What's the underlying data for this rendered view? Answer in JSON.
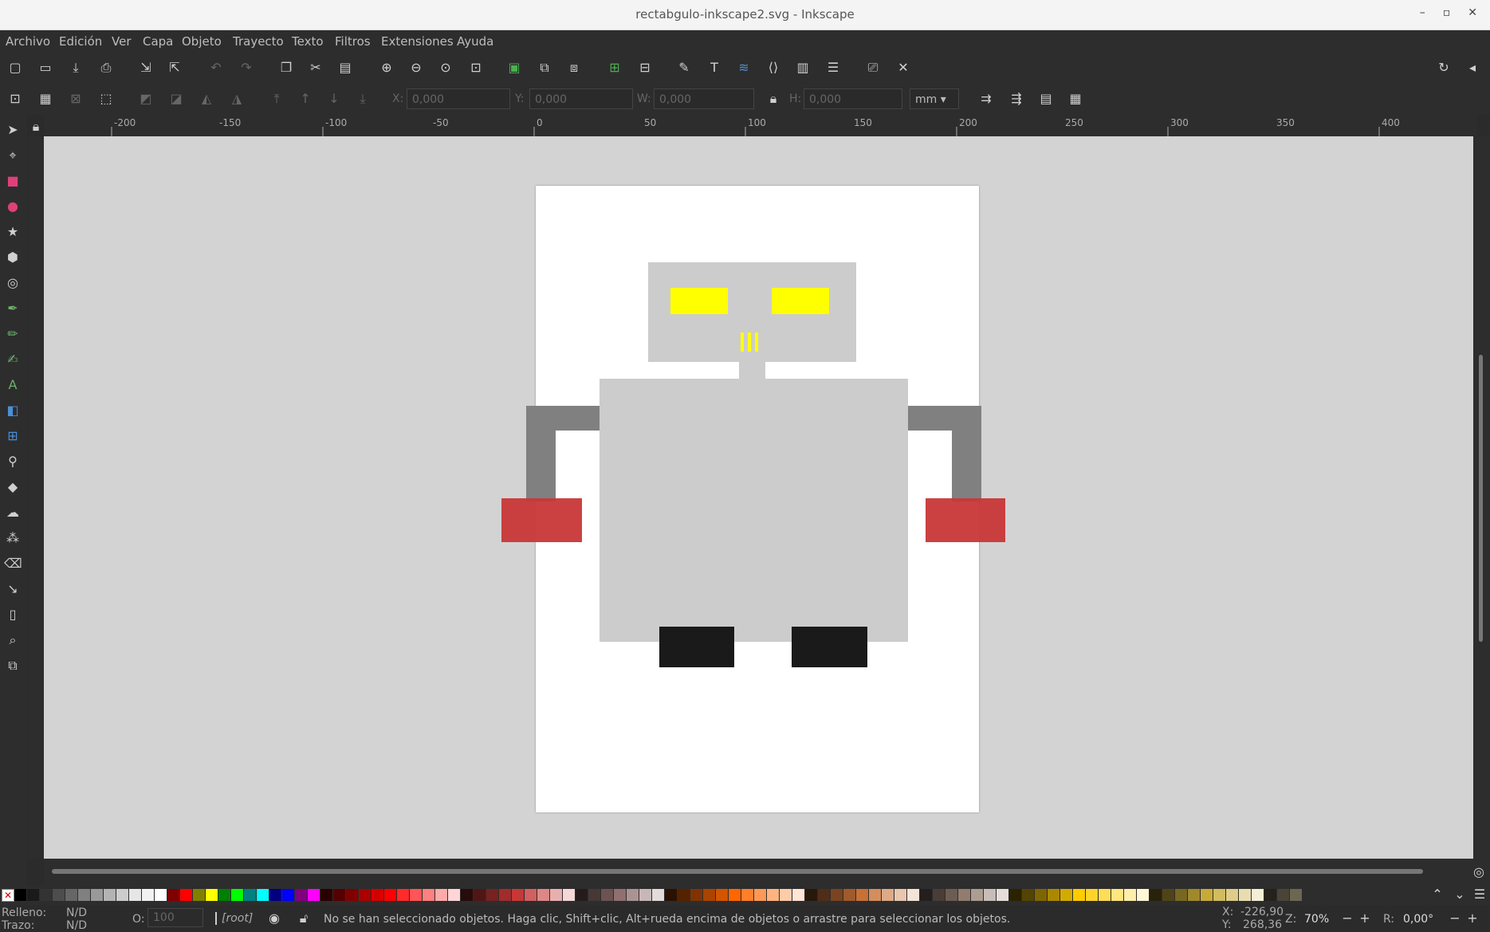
{
  "window": {
    "title": "rectabgulo-inkscape2.svg - Inkscape",
    "minimize": "–",
    "maximize": "▫",
    "close": "✕"
  },
  "menu": [
    "Archivo",
    "Edición",
    "Ver",
    "Capa",
    "Objeto",
    "Trayecto",
    "Texto",
    "Filtros",
    "Extensiones",
    "Ayuda"
  ],
  "toolbar": {
    "x_label": "X:",
    "x_value": "0,000",
    "y_label": "Y:",
    "y_value": "0,000",
    "w_label": "W:",
    "w_value": "0,000",
    "h_label": "H:",
    "h_value": "0,000",
    "unit": "mm"
  },
  "ruler": {
    "h_labels": [
      "-200",
      "-150",
      "-100",
      "-50",
      "0",
      "50",
      "100",
      "150",
      "200",
      "250",
      "300",
      "350",
      "400"
    ]
  },
  "colors": {
    "robot_gray": "#cccccc",
    "eyes": "#ffff00",
    "arm": "#808080",
    "hand": "#c83737",
    "foot": "#1a1a1a",
    "page": "#ffffff",
    "canvas": "#d3d3d3"
  },
  "palette": [
    "#000000",
    "#1a1a1a",
    "#333333",
    "#4d4d4d",
    "#666666",
    "#808080",
    "#999999",
    "#b3b3b3",
    "#cccccc",
    "#e6e6e6",
    "#f2f2f2",
    "#ffffff",
    "#800000",
    "#ff0000",
    "#808000",
    "#ffff00",
    "#008000",
    "#00ff00",
    "#008080",
    "#00ffff",
    "#000080",
    "#0000ff",
    "#800080",
    "#ff00ff",
    "#2b0000",
    "#550000",
    "#800000",
    "#aa0000",
    "#d40000",
    "#ff0000",
    "#ff2a2a",
    "#ff5555",
    "#ff8080",
    "#ffaaaa",
    "#ffd5d5",
    "#280b0b",
    "#501616",
    "#782121",
    "#a02c2c",
    "#c83737",
    "#d35f5f",
    "#de8787",
    "#e9afaf",
    "#f4d7d7",
    "#241c1c",
    "#483737",
    "#6c5353",
    "#916f6f",
    "#ac9393",
    "#c8b7b7",
    "#e3dbdb",
    "#2b1100",
    "#552200",
    "#803300",
    "#aa4400",
    "#d45500",
    "#ff6600",
    "#ff7f2a",
    "#ff9955",
    "#ffb380",
    "#ffccaa",
    "#ffe6d5",
    "#28170b",
    "#502d16",
    "#784421",
    "#a05a2c",
    "#c87137",
    "#d38d5f",
    "#deaa87",
    "#e9c6af",
    "#f4e3d7",
    "#241f1c",
    "#483e37",
    "#6c5d53",
    "#917c6f",
    "#ac9d93",
    "#c8beb7",
    "#e3dedb",
    "#2b2200",
    "#554400",
    "#806600",
    "#aa8800",
    "#d4aa00",
    "#ffcc00",
    "#ffd42a",
    "#ffdd55",
    "#ffe680",
    "#ffeeaa",
    "#fff6d5",
    "#28220b",
    "#504416",
    "#786721",
    "#a0892c",
    "#c8ab37",
    "#d3bc5f",
    "#decd87",
    "#e9ddaf",
    "#f4eed7",
    "#24221c",
    "#484537",
    "#6c6753"
  ],
  "status": {
    "fill_label": "Relleno:",
    "fill_value": "N/D",
    "stroke_label": "Trazo:",
    "stroke_value": "N/D",
    "opacity_label": "O:",
    "opacity_value": "100",
    "layer": "[root]",
    "message": "No se han seleccionado objetos. Haga clic, Shift+clic, Alt+rueda encima de objetos o arrastre para seleccionar los objetos.",
    "x_label": "X:",
    "x_value": "-226,90",
    "y_label": "Y:",
    "y_value": "268,36",
    "zoom_label": "Z:",
    "zoom_value": "70%",
    "rotation_label": "R:",
    "rotation_value": "0,00°"
  }
}
